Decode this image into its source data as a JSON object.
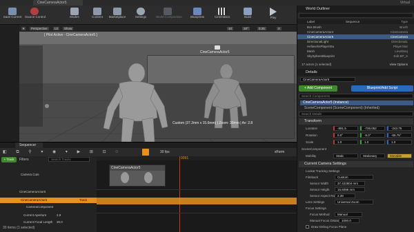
{
  "title_bar": {
    "tab_label": "CineCameraActor5",
    "app_label": "Virtual"
  },
  "toolbar": {
    "buttons": [
      {
        "label": "Save Current",
        "icon": "save-icon",
        "color": "#7a8fb0"
      },
      {
        "label": "Source Control",
        "icon": "source-control-icon",
        "color": "#b04040"
      },
      {
        "label": "Modes",
        "icon": "modes-icon",
        "color": "#9aa5b5"
      },
      {
        "label": "Content",
        "icon": "content-icon",
        "color": "#8c99aa"
      },
      {
        "label": "Marketplace",
        "icon": "marketplace-icon",
        "color": "#8c99aa"
      },
      {
        "label": "Settings",
        "icon": "settings-icon",
        "color": "#9aa5b5"
      },
      {
        "label": "World Composition",
        "icon": "world-icon",
        "color": "#555a62"
      },
      {
        "label": "Blueprints",
        "icon": "blueprint-icon",
        "color": "#6a88c0"
      },
      {
        "label": "Cinematics",
        "icon": "cinematics-icon",
        "color": "#bbbbbb"
      },
      {
        "label": "Build",
        "icon": "build-icon",
        "color": "#8aa0c0"
      },
      {
        "label": "Play",
        "icon": "play-icon",
        "color": "#c0c8d0"
      }
    ]
  },
  "viewport": {
    "mode": "Perspective",
    "view": "Lit",
    "show": "Show",
    "pilot_label": "[ Pilot Active - CineCameraActor5 ]",
    "camera_tag": "CineCameraActor5",
    "camera_info": "Custom (37.2mm x 15.6mm) | Zoom: 30mm | Av: 2.8",
    "snap_values": [
      "10",
      "10°",
      "0.25",
      "4"
    ]
  },
  "outliner": {
    "title": "World Outliner",
    "col_label": "Label",
    "col_type": "Sequence",
    "col_type2": "Type",
    "rows": [
      {
        "label": "Box Brush",
        "type": "Brush",
        "selected": false
      },
      {
        "label": "CineCameraActor4",
        "type": "CineCamera",
        "selected": false
      },
      {
        "label": "CineCameraActor5",
        "type": "CineCamera",
        "selected": true
      },
      {
        "label": "DirectionalLight",
        "type": "DirectionalL",
        "selected": false
      },
      {
        "label": "HeliworksPlayerSta",
        "type": "PlayerStar",
        "selected": false
      },
      {
        "label": "Mesh",
        "type": "LevelSeq",
        "selected": false
      },
      {
        "label": "SkySphereBlueprint",
        "type": "Edit BP_S",
        "selected": false
      }
    ],
    "footer_count": "17 actors (1 selected)",
    "view_options": "View Options"
  },
  "details": {
    "title": "Details",
    "actor_name": "CineCameraActor5",
    "add_component": "+ Add Component",
    "blueprint_script": "Blueprint/Add Script",
    "search_components": "Search Components",
    "root_component": "CineCameraActor5 (Instance)",
    "scene_component": "SceneComponent (SceneComponent) (Inherited)",
    "search_details": "Search Details",
    "transform_section": "Transform",
    "location": {
      "label": "Location",
      "x": "-891.5",
      "y": "-726.052",
      "z": "-243.75"
    },
    "rotation": {
      "label": "Rotation",
      "x": "0.0°",
      "y": "-5.0°",
      "z": "-65.75°"
    },
    "scale": {
      "label": "Scale",
      "x": "1.0",
      "y": "1.0",
      "z": "1.0"
    },
    "scene_component_label": "SceneComponent",
    "mobility": {
      "label": "Mobility",
      "options": [
        "Static",
        "Stationary",
        "Movable"
      ]
    },
    "camera_settings_section": "Current Camera Settings",
    "lookat_label": "Lookat Tracking Settings",
    "filmback_label": "Filmback",
    "filmback_value": "Custom",
    "sensor_width_label": "Sensor Width",
    "sensor_width": "37.422804 mm",
    "sensor_height_label": "Sensor Height",
    "sensor_height": "15.6096 mm",
    "sensor_aspect_label": "Sensor Aspect Ratio",
    "sensor_aspect": "2.39",
    "lens_settings_label": "Lens Settings",
    "lens_value": "Universal Zoom",
    "focus_settings_label": "Focus Settings",
    "focus_method_label": "Focus Method",
    "focus_method": "Manual",
    "manual_focus_label": "Manual Focus Distance",
    "manual_focus": "1000.0",
    "draw_debug_label": "Draw Debug Focus Plane"
  },
  "sequencer": {
    "tab_label": "Sequencer",
    "track_button": "+ Track",
    "filters": "Filters",
    "search_placeholder": "Search Tracks",
    "fps": "30 fps",
    "frame": "0091",
    "sequence_name": "xForm",
    "rows": [
      {
        "label": "Camera Cuts",
        "indent": 0
      },
      {
        "label": "CineCameraActor5",
        "indent": 0
      },
      {
        "label": "CineCameraActor5",
        "indent": 0,
        "selected": true
      },
      {
        "label": "CameraComponent",
        "indent": 1
      },
      {
        "label": "Current Aperture",
        "indent": 2,
        "value": "2.8"
      },
      {
        "label": "Current Focal Length",
        "indent": 2,
        "value": "30.0"
      }
    ],
    "track_button_row": "Track",
    "clip_label": "CineCameraActor5",
    "items_footer": "30 items (1 selected)"
  },
  "colors": {
    "selection_blue": "#3b5a86",
    "sequencer_orange": "#e8901e",
    "add_green": "#3e8a2a",
    "blueprint_blue": "#2e68b8"
  }
}
